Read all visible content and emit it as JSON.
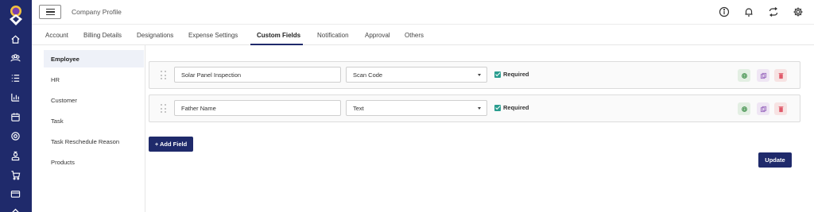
{
  "header": {
    "title": "Company Profile"
  },
  "tabs": [
    {
      "label": "Account"
    },
    {
      "label": "Billing Details"
    },
    {
      "label": "Designations"
    },
    {
      "label": "Expense Settings"
    },
    {
      "label": "Custom Fields",
      "active": true
    },
    {
      "label": "Notification"
    },
    {
      "label": "Approval"
    },
    {
      "label": "Others"
    }
  ],
  "categories": [
    {
      "label": "Employee",
      "active": true
    },
    {
      "label": "HR"
    },
    {
      "label": "Customer"
    },
    {
      "label": "Task"
    },
    {
      "label": "Task Reschedule Reason"
    },
    {
      "label": "Products"
    }
  ],
  "fields": [
    {
      "name": "Solar Panel Inspection",
      "type": "Scan Code",
      "required_label": "Required",
      "required": true
    },
    {
      "name": "Father Name",
      "type": "Text",
      "required_label": "Required",
      "required": true
    }
  ],
  "actions": {
    "add_field": "+ Add Field",
    "update": "Update"
  },
  "icons": {
    "rail": [
      "home-icon",
      "team-icon",
      "list-icon",
      "bar-chart-icon",
      "calendar-icon",
      "target-icon",
      "user-badge-icon",
      "cart-icon",
      "card-icon"
    ],
    "top": [
      "info-icon",
      "bell-icon",
      "sync-icon",
      "gear-icon"
    ]
  },
  "colors": {
    "brand": "#1f2a6b",
    "check": "#2a9d8f",
    "delete": "#e05a6a",
    "settings": "#3f8f4a",
    "copy": "#9b6bbf"
  }
}
